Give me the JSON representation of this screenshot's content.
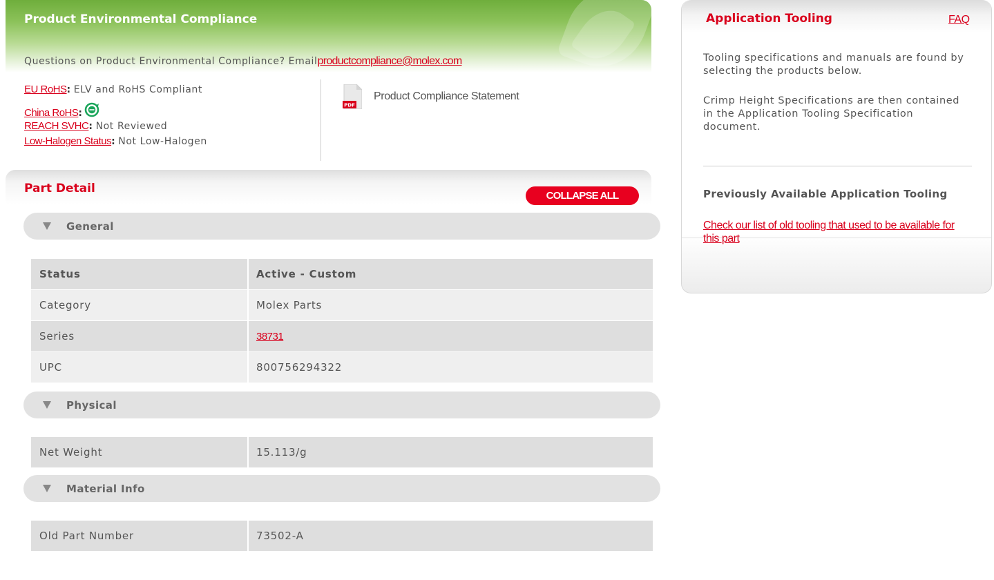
{
  "compliance": {
    "title": "Product Environmental Compliance",
    "question_text": "Questions on Product Environmental Compliance? Email",
    "email_link": "productcompliance@molex.com",
    "items": [
      {
        "label": "EU RoHS",
        "colon": ":",
        "value": "ELV and RoHS Compliant"
      },
      {
        "label": "China RoHS",
        "colon": ":",
        "value": "",
        "icon": "china-rohs-e-icon"
      },
      {
        "label": "REACH SVHC",
        "colon": ":",
        "value": "Not Reviewed"
      },
      {
        "label": "Low-Halogen Status",
        "colon": ":",
        "value": "Not Low-Halogen"
      }
    ],
    "statement": {
      "icon": "pdf-icon",
      "icon_text": "PDF",
      "label": "Product Compliance Statement"
    }
  },
  "part_detail": {
    "title": "Part Detail",
    "collapse_label": "COLLAPSE ALL",
    "sections": [
      {
        "name": "General",
        "rows": [
          {
            "label": "Status",
            "value": "Active - Custom"
          },
          {
            "label": "Category",
            "value": "Molex Parts"
          },
          {
            "label": "Series",
            "value": "38731"
          },
          {
            "label": "UPC",
            "value": "800756294322"
          }
        ]
      },
      {
        "name": "Physical",
        "rows": [
          {
            "label": "Net Weight",
            "value": "15.113/g"
          }
        ]
      },
      {
        "name": "Material Info",
        "rows": [
          {
            "label": "Old Part Number",
            "value": "73502-A"
          }
        ]
      }
    ]
  },
  "tooling": {
    "title": "Application Tooling",
    "faq_label": "FAQ",
    "para1": "Tooling specifications and manuals are found by selecting the products below.",
    "para2": "Crimp Height Specifications are then contained in the Application Tooling Specification document.",
    "prev_title": "Previously Available Application Tooling",
    "prev_link": "Check our list of old tooling that used to be available for this part"
  },
  "colors": {
    "brand_red": "#d9001c",
    "compliance_green": "#6fae3c",
    "china_rohs_green": "#1aa55a"
  }
}
